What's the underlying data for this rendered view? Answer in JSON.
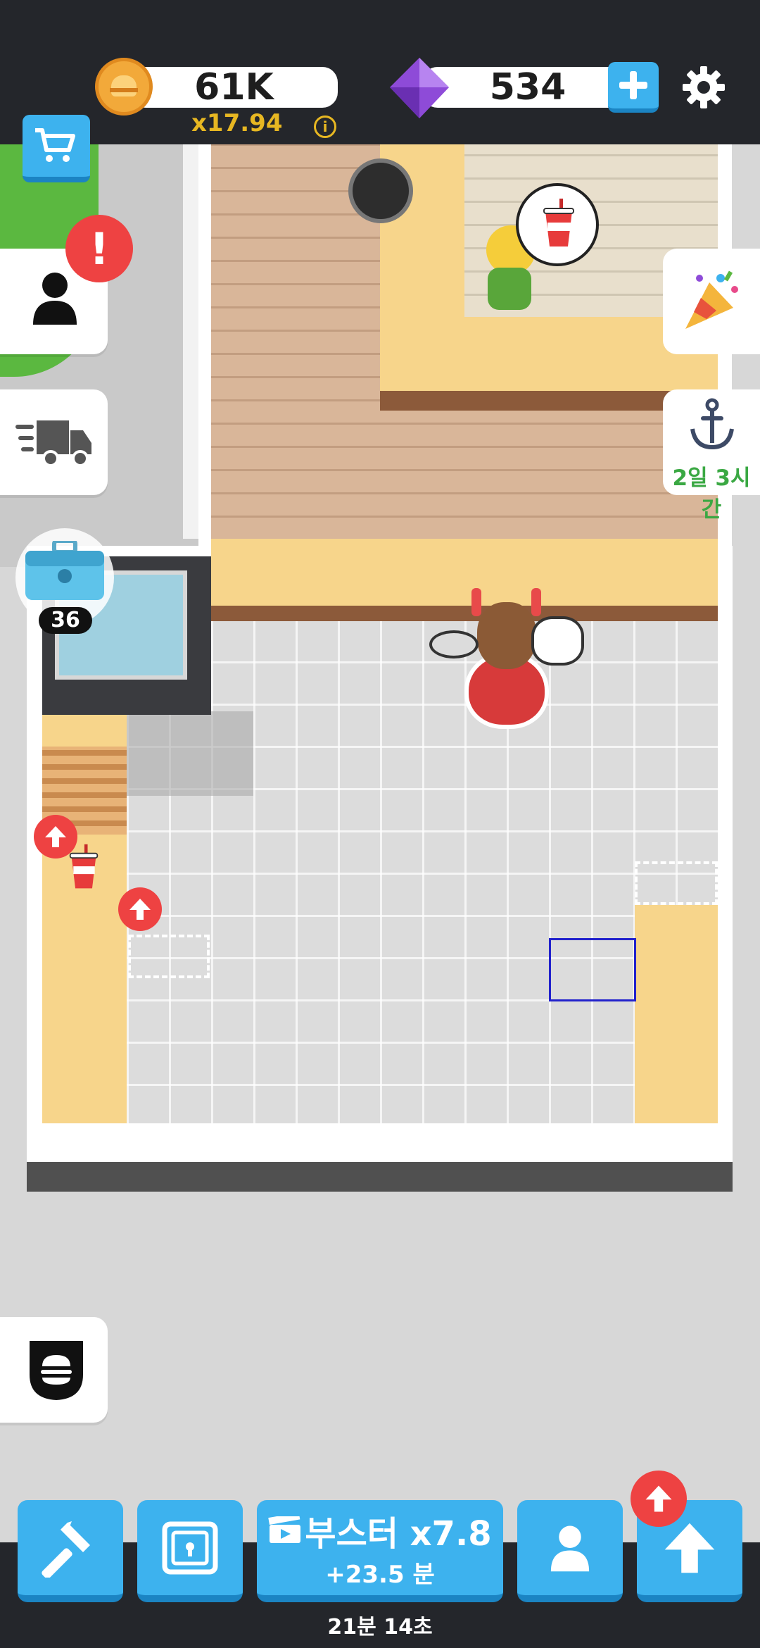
{
  "hud": {
    "coins": "61K",
    "multiplier": "x17.94",
    "gems": "534",
    "info_symbol": "i"
  },
  "side": {
    "counter_badge": "36",
    "event_timer": "2일 3시간"
  },
  "bottom": {
    "booster_label": "부스터 x7.8",
    "booster_sub": "+23.5 분",
    "timer": "21분 14초"
  },
  "colors": {
    "accent_blue": "#3db2ee",
    "dark_bar": "#24262b",
    "alert_red": "#ee4242",
    "counter_tan": "#f7d58b",
    "brick": "#d9b699",
    "gold_text": "#e7b722"
  },
  "icons": [
    "coin-icon",
    "gem-icon",
    "plus-icon",
    "gear-icon",
    "cart-icon",
    "person-icon",
    "alert-icon",
    "truck-icon",
    "toolbox-icon",
    "party-popper-icon",
    "anchor-icon",
    "burger-shield-icon",
    "hammer-icon",
    "safe-icon",
    "video-icon",
    "staff-icon",
    "upgrade-arrow-icon",
    "drink-cup-icon"
  ]
}
